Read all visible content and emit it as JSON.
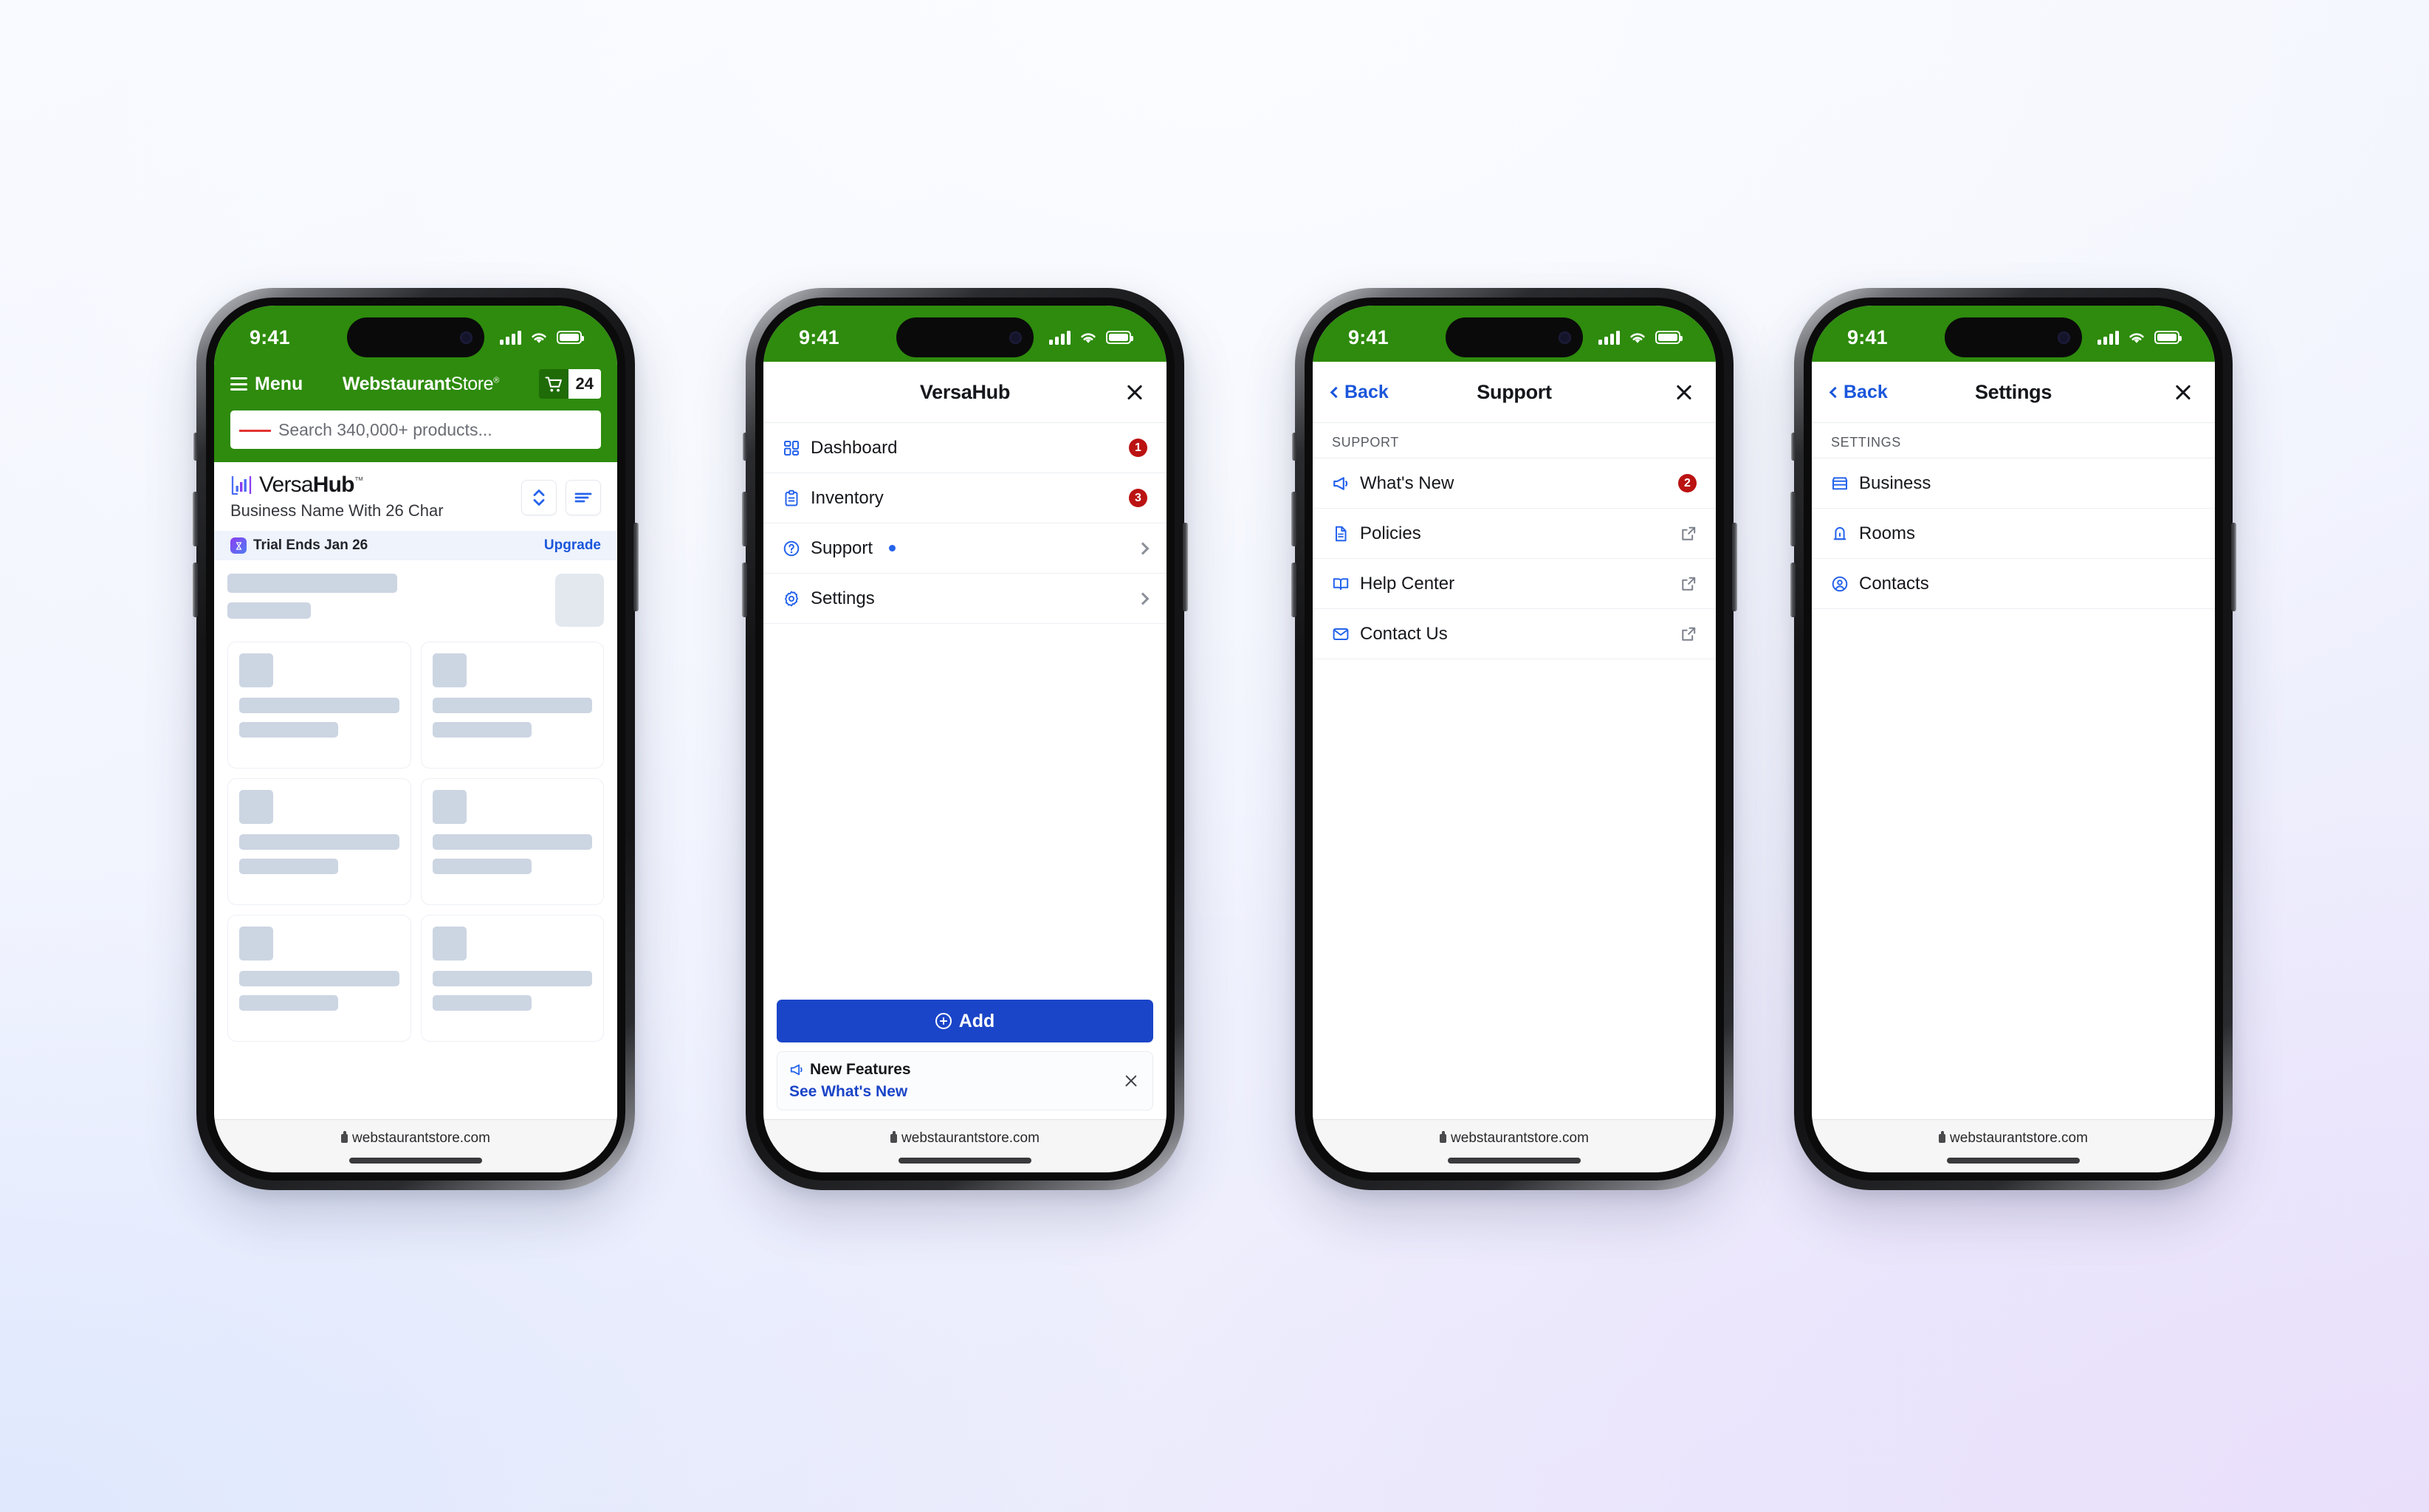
{
  "meta": {
    "accent_green": "#2e8b0d",
    "brand_blue": "#1a56db",
    "badge_red": "#bb1212",
    "skeleton_gray": "#ccd5e2"
  },
  "status_bar": {
    "time": "9:41"
  },
  "browser": {
    "url": "webstaurantstore.com",
    "lock_icon": "lock-icon"
  },
  "phone1": {
    "header": {
      "menu_label": "Menu",
      "menu_icon": "hamburger-icon",
      "brand_bold": "Webstaurant",
      "brand_light": "Store",
      "brand_mark": "®",
      "cart_icon": "shopping-cart-icon",
      "cart_count": "24"
    },
    "search": {
      "placeholder": "Search 340,000+ products...",
      "icon": "barcode-scan-icon"
    },
    "hub": {
      "logo_icon": "versahub-bar-chart-logo",
      "name_light": "Versa",
      "name_bold": "Hub",
      "name_mark": "™",
      "business_name": "Business Name With 26 Char",
      "sort_button_icon": "sort-updown-icon",
      "filter_button_icon": "filter-lines-icon"
    },
    "trial": {
      "icon": "trial-hourglass-icon",
      "text": "Trial Ends Jan 26",
      "action": "Upgrade"
    },
    "skeleton": {
      "rows": 3,
      "cards_per_row": 2,
      "note": "loading placeholder content"
    }
  },
  "phone2": {
    "title": "VersaHub",
    "close_icon": "close-icon",
    "items": [
      {
        "label": "Dashboard",
        "icon": "dashboard-grid-icon",
        "badge": "1",
        "chevron": false
      },
      {
        "label": "Inventory",
        "icon": "clipboard-list-icon",
        "badge": "3",
        "chevron": false
      },
      {
        "label": "Support",
        "icon": "question-circle-icon",
        "dot": true,
        "chevron": true
      },
      {
        "label": "Settings",
        "icon": "gear-icon",
        "chevron": true
      }
    ],
    "add_button": {
      "label": "Add",
      "icon": "plus-circle-icon"
    },
    "new_features": {
      "icon": "megaphone-icon",
      "title": "New Features",
      "link": "See What's New",
      "close_icon": "close-icon"
    }
  },
  "phone3": {
    "back_label": "Back",
    "title": "Support",
    "close_icon": "close-icon",
    "section_label": "SUPPORT",
    "items": [
      {
        "label": "What's New",
        "icon": "megaphone-icon",
        "badge": "2"
      },
      {
        "label": "Policies",
        "icon": "document-icon",
        "external": true
      },
      {
        "label": "Help Center",
        "icon": "open-book-icon",
        "external": true
      },
      {
        "label": "Contact Us",
        "icon": "envelope-icon",
        "external": true
      }
    ]
  },
  "phone4": {
    "back_label": "Back",
    "title": "Settings",
    "close_icon": "close-icon",
    "section_label": "SETTINGS",
    "items": [
      {
        "label": "Business",
        "icon": "storefront-icon"
      },
      {
        "label": "Rooms",
        "icon": "room-door-icon"
      },
      {
        "label": "Contacts",
        "icon": "user-circle-icon"
      }
    ]
  }
}
